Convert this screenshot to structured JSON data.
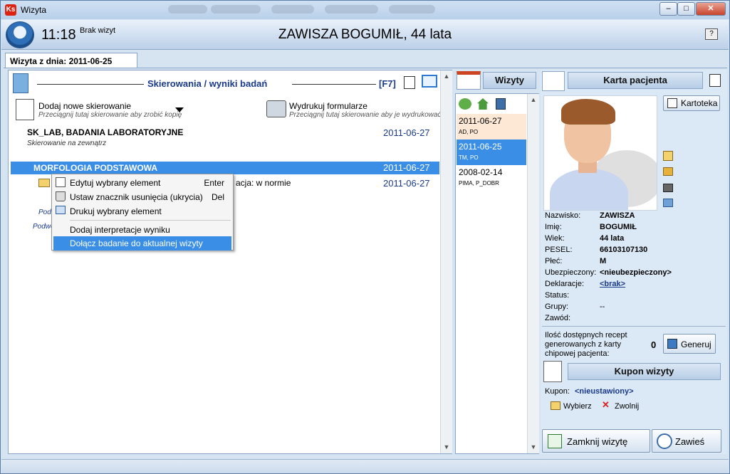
{
  "window": {
    "title": "Wizyta",
    "app_icon": "Ks"
  },
  "header": {
    "time": "11:18",
    "visits_status": "Brak wizyt",
    "patient_name": "ZAWISZA BOGUMIŁ, 44 lata"
  },
  "tab": {
    "label": "Wizyta z dnia: 2011-06-25"
  },
  "referrals": {
    "section_title": "Skierowania / wyniki badań",
    "shortcut": "[F7]",
    "add_label": "Dodaj nowe skierowanie",
    "add_hint": "Przeciągnij tutaj skierowanie aby zrobić kopię",
    "print_label": "Wydrukuj formularze",
    "print_hint": "Przeciągnij tutaj skierowanie aby je wydrukować",
    "group_title": "SK_LAB, BADANIA LABORATORYJNE",
    "group_date": "2011-06-27",
    "group_note": "Skierowanie na zewnątrz",
    "selected_item": "MORFOLOGIA PODSTAWOWA",
    "selected_date": "2011-06-27",
    "sub_item_fragment": "acja: w normie",
    "sub_item_date": "2011-06-27",
    "fragment_1": "Podv",
    "fragment_2": "Podwo"
  },
  "context_menu": [
    {
      "label": "Edytuj wybrany element",
      "shortcut": "Enter"
    },
    {
      "label": "Ustaw znacznik usunięcia (ukrycia)",
      "shortcut": "Del"
    },
    {
      "label": "Drukuj wybrany element",
      "shortcut": ""
    },
    {
      "label": "Dodaj interpretacje wyniku",
      "shortcut": ""
    },
    {
      "label": "Dołącz badanie do aktualnej wizyty",
      "shortcut": ""
    }
  ],
  "visits": {
    "header": "Wizyty",
    "items": [
      {
        "date": "2011-06-27",
        "staff": "AD, PO"
      },
      {
        "date": "2011-06-25",
        "staff": "TM, PO"
      },
      {
        "date": "2008-02-14",
        "staff": "PIMA, P_DOBR"
      }
    ]
  },
  "patient": {
    "card_header": "Karta pacjenta",
    "kartoteka_button": "Kartoteka",
    "fields": [
      {
        "label": "Nazwisko:",
        "value": "ZAWISZA"
      },
      {
        "label": "Imię:",
        "value": "BOGUMIŁ"
      },
      {
        "label": "Wiek:",
        "value": "44 lata"
      },
      {
        "label": "PESEL:",
        "value": "66103107130"
      },
      {
        "label": "Płeć:",
        "value": "M"
      },
      {
        "label": "Ubezpieczony:",
        "value": "<nieubezpieczony>"
      },
      {
        "label": "Deklaracje:",
        "value": "<brak>"
      },
      {
        "label": "Status:",
        "value": ""
      },
      {
        "label": "Grupy:",
        "value": "--"
      },
      {
        "label": "Zawód:",
        "value": ""
      }
    ],
    "recipes_label": "Ilość dostępnych recept generowanych z karty chipowej pacjenta:",
    "recipes_count": "0",
    "generate_button": "Generuj"
  },
  "coupon": {
    "header": "Kupon wizyty",
    "label": "Kupon:",
    "value": "<nieustawiony>",
    "choose": "Wybierz",
    "release": "Zwolnij"
  },
  "footer_buttons": {
    "close_visit": "Zamknij wizytę",
    "suspend": "Zawieś"
  },
  "colors": {
    "accent": "#3a8ee6",
    "section_title": "#1a3a8c",
    "visit_highlight": "#fde8d6"
  }
}
